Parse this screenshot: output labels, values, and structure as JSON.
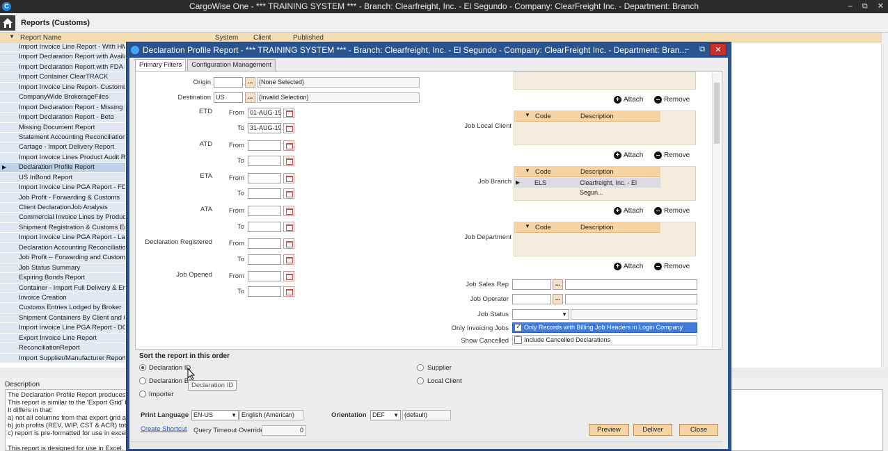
{
  "app": {
    "title": "CargoWise One - *** TRAINING SYSTEM *** - Branch: Clearfreight, Inc. - El Segundo - Company: ClearFreight Inc. - Department: Branch",
    "logo": "C",
    "minimize": "–",
    "restore": "⧉",
    "close": "✕"
  },
  "header": {
    "title": "Reports (Customs)"
  },
  "grid": {
    "columns": [
      "Report Name",
      "System",
      "Client",
      "Published"
    ],
    "rows": [
      "Import Invoice Line Report - With HM",
      "Import Declaration Report with Availa",
      "Import Declaration Report with FDA M",
      "Import Container ClearTRACK",
      "Import Invoice Line Report- Customiz",
      "CompanyWide BrokerageFiles",
      "Import Declaration Report - Missing D",
      "Import Declaration Report - Beto",
      "Missing Document Report",
      "Statement Accounting Reconciliation R",
      "Cartage - Import Delivery Report",
      "Import Invoice Lines Product Audit Re",
      "Declaration Profile Report",
      "US InBond Report",
      "Import Invoice Line PGA Report - FDA",
      "Job Profit - Forwarding & Customs",
      "Client DeclarationJob Analysis",
      "Commercial Invoice Lines by Product",
      "Shipment Registration & Customs Ent",
      "Import Invoice Line PGA Report - Lac",
      "Declaration Accounting Reconciliation",
      "Job Profit -- Forwarding and Customs",
      "Job Status Summary",
      "Expiring Bonds Report",
      "Container - Import Full Delivery & Em",
      "Invoice Creation",
      "Customs Entries Lodged by Broker",
      "Shipment Containers By Client and Ca",
      "Import Invoice Line PGA Report - DOT",
      "Export Invoice Line Report",
      "ReconciliationReport",
      "Import Supplier/Manufacturer Report"
    ],
    "selected_index": 12
  },
  "description": {
    "label": "Description",
    "lines": [
      "The Declaration Profile Report produces a lis",
      "This report is similar to the 'Export Grid' func",
      "It differs in that:",
      "a) not all columns from that export grid are i",
      "b) job profits (REV, WIP, CST & ACR) totals",
      "c) report is pre-formatted for use in excel.",
      "",
      "This report is designed for use in Excel."
    ]
  },
  "dialog": {
    "title": "Declaration Profile Report - *** TRAINING SYSTEM *** - Branch: Clearfreight, Inc. - El Segundo - Company: ClearFreight Inc. - Department: Bran...",
    "tabs": [
      "Primary Filters",
      "Configuration Management"
    ],
    "filters": {
      "origin_label": "Origin",
      "origin_value": "",
      "origin_desc": "{None Selected}",
      "destination_label": "Destination",
      "destination_value": "US",
      "destination_desc": "{Invalid Selection}",
      "ellipsis": "...",
      "from": "From",
      "to": "To",
      "etd_label": "ETD",
      "etd_from": "01-AUG-19",
      "etd_to": "31-AUG-19",
      "atd_label": "ATD",
      "eta_label": "ETA",
      "ata_label": "ATA",
      "decl_reg_label": "Declaration Registered",
      "job_opened_label": "Job Opened",
      "attach": "Attach",
      "remove": "Remove",
      "job_local_client_label": "Job Local Client",
      "job_branch_label": "Job Branch",
      "job_department_label": "Job Department",
      "code_col": "Code",
      "desc_col": "Description",
      "branch_code": "ELS",
      "branch_desc": "Clearfreight, Inc. - El Segun...",
      "job_sales_rep_label": "Job Sales Rep",
      "job_operator_label": "Job Operator",
      "job_status_label": "Job Status",
      "only_invoicing_label": "Only Invoicing Jobs",
      "only_invoicing_text": "Only Records with Billing Job Headers in Login Company",
      "show_cancelled_label": "Show Cancelled",
      "show_cancelled_text": "Include Cancelled Declarations"
    },
    "sort": {
      "title": "Sort the report in this order",
      "options": [
        "Declaration ID",
        "Declaration Br",
        "Importer",
        "Supplier",
        "Local Client"
      ],
      "selected": "Declaration ID",
      "tooltip": "Declaration ID"
    },
    "footer": {
      "print_language_label": "Print Language",
      "print_language_code": "EN-US",
      "print_language_name": "English (American)",
      "orientation_label": "Orientation",
      "orientation_code": "DEF",
      "orientation_name": "(default)",
      "create_shortcut": "Create Shortcut",
      "query_timeout_label": "Query Timeout Override",
      "query_timeout_value": "0",
      "preview": "Preview",
      "deliver": "Deliver",
      "close": "Close"
    }
  }
}
